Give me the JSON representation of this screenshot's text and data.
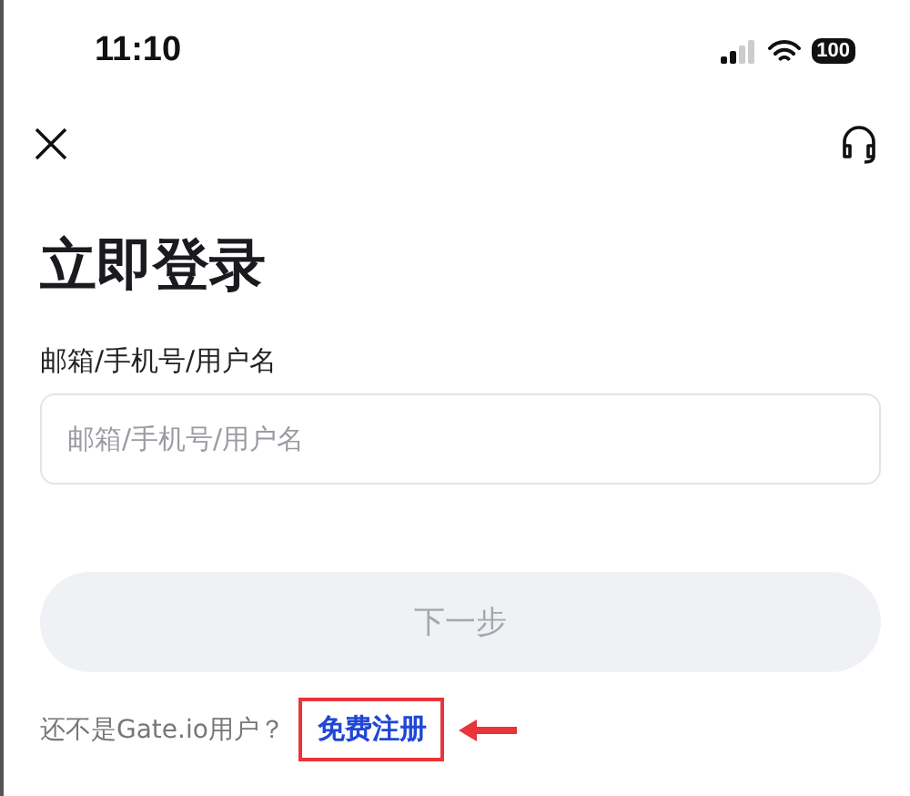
{
  "status_bar": {
    "time": "11:10",
    "battery": "100"
  },
  "title": "立即登录",
  "account_field": {
    "label": "邮箱/手机号/用户名",
    "placeholder": "邮箱/手机号/用户名"
  },
  "next_button": {
    "label": "下一步",
    "disabled": true
  },
  "signup": {
    "prompt": "还不是Gate.io用户？",
    "link": "免费注册",
    "highlighted": true
  }
}
